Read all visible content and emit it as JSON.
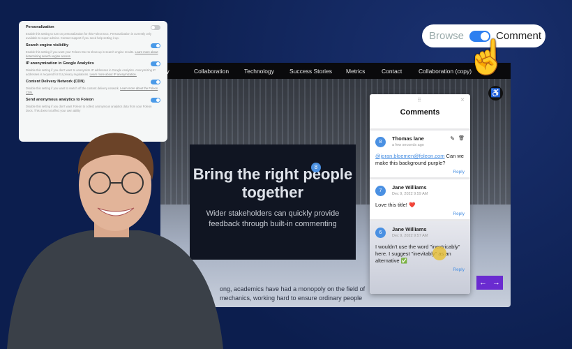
{
  "settings": {
    "items": [
      {
        "title": "Personalization",
        "desc": "Enable this setting to turn on personalization for this Foleon Doc. Personalization is currently only available to super admins. Contact support if you need help setting it up.",
        "link": "",
        "on": false
      },
      {
        "title": "Search engine visibility",
        "desc": "Enable this setting if you want your Foleon Doc to show up in search engine results.",
        "link": "Learn more about determining search engine access.",
        "on": true
      },
      {
        "title": "IP anonymization in Google Analytics",
        "desc": "Disable this setting if you don't want to anonymize IP addresses in Google Analytics. Anonymizing IP addresses is required for EU privacy regulations.",
        "link": "Learn more about IP anonymization.",
        "on": true
      },
      {
        "title": "Content Delivery Network (CDN)",
        "desc": "Disable this setting if you want to switch off the content delivery network.",
        "link": "Learn more about the Foleon CDN.",
        "on": true
      },
      {
        "title": "Send anonymous analytics to Foleon",
        "desc": "Disable this setting if you don't want Foleon to collect anonymous analytics data from your Foleon Docs. This does not affect your own ability",
        "link": "",
        "on": true
      }
    ]
  },
  "mode_toggle": {
    "left": "Browse",
    "right": "Comment",
    "on": true
  },
  "nav": [
    "vity",
    "Collaboration",
    "Technology",
    "Success Stories",
    "Metrics",
    "Contact",
    "Collaboration (copy)"
  ],
  "hero": {
    "title": "Bring the right people together",
    "subtitle": "Wider stakeholders can quickly provide feedback through built-in commenting",
    "badge": "8"
  },
  "body_text": [
    "ong, academics have had a monopoly on the field of",
    "mechanics, working hard to ensure ordinary people"
  ],
  "comments": {
    "title": "Comments",
    "reply": "Reply",
    "items": [
      {
        "num": "8",
        "name": "Thomas lane",
        "date": "a few seconds ago",
        "mention": "@joran.bloemen@foleon.com",
        "text": " Can we make this background purple?"
      },
      {
        "num": "7",
        "name": "Jane Williams",
        "date": "Dec 9, 2022 9:59 AM",
        "mention": "",
        "text": "Love this title! ❤️"
      },
      {
        "num": "6",
        "name": "Jane Williams",
        "date": "Dec 9, 2022 9:57 AM",
        "mention": "",
        "text": "I wouldn't use the word \"inextricably\" here. I suggest \"inevitably\" as an alternative ✅"
      }
    ]
  },
  "colors": {
    "background": "#0c1e4e",
    "accent": "#2d7ff0",
    "nav_arrows": "#6a2bd0"
  }
}
